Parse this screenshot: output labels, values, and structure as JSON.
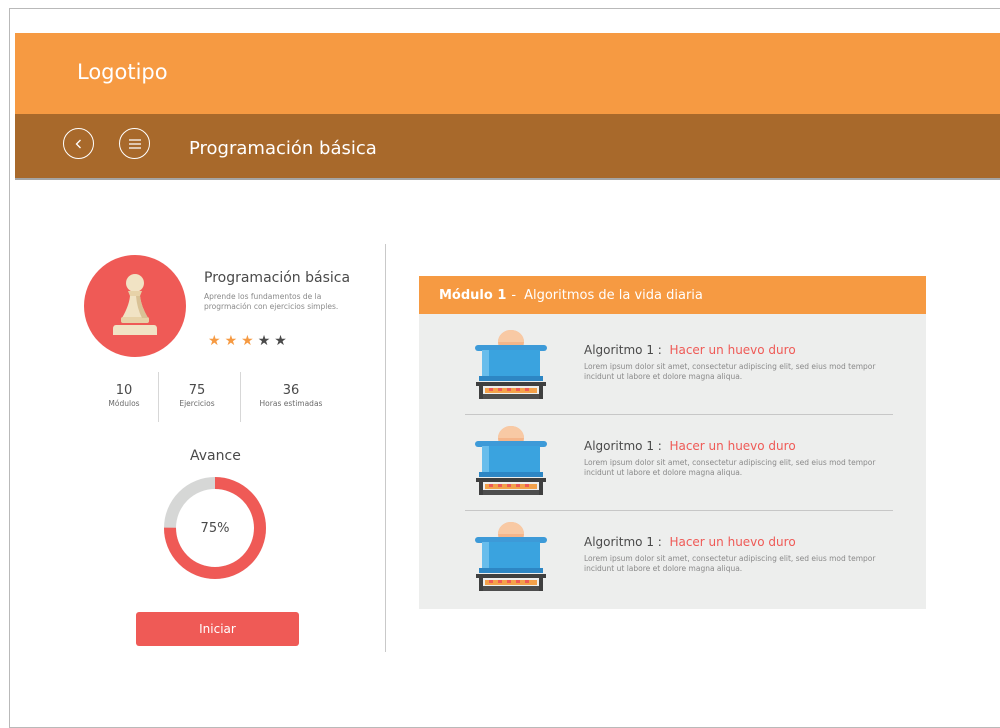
{
  "header": {
    "logo": "Logotipo"
  },
  "nav": {
    "title": "Programación básica",
    "back_icon": "chevron-left-icon",
    "menu_icon": "menu-icon"
  },
  "course": {
    "title": "Programación básica",
    "description": "Aprende los fundamentos de la progrmación con ejercicios simples.",
    "rating": 3,
    "rating_max": 5,
    "stats": [
      {
        "value": "10",
        "label": "Módulos"
      },
      {
        "value": "75",
        "label": "Ejercicios"
      },
      {
        "value": "36",
        "label": "Horas estimadas"
      }
    ],
    "progress_label": "Avance",
    "progress_text": "75%",
    "progress_value": 0.75,
    "start_label": "Iniciar"
  },
  "module": {
    "number": "Módulo 1",
    "separator": "-",
    "name": "Algoritmos de la vida diaria",
    "algorithms": [
      {
        "prefix": "Algoritmo 1 :",
        "title": "Hacer un huevo duro",
        "description": "Lorem ipsum dolor sit amet, consectetur adipiscing elit, sed eius mod tempor incidunt ut labore et dolore magna aliqua.",
        "icon": "pot-egg-stove-icon"
      },
      {
        "prefix": "Algoritmo 1 :",
        "title": "Hacer un huevo duro",
        "description": "Lorem ipsum dolor sit amet, consectetur adipiscing elit, sed eius mod tempor incidunt ut labore et dolore magna aliqua.",
        "icon": "pot-egg-stove-icon"
      },
      {
        "prefix": "Algoritmo 1 :",
        "title": "Hacer un huevo duro",
        "description": "Lorem ipsum dolor sit amet, consectetur adipiscing elit, sed eius mod tempor incidunt ut labore et dolore magna aliqua.",
        "icon": "pot-egg-stove-icon"
      }
    ]
  },
  "colors": {
    "orange": "#f69a42",
    "brown": "#a8692b",
    "red": "#ef5a56",
    "grey_panel": "#edeeed",
    "star_filled": "#f69a42",
    "star_empty": "#4a4a4a"
  }
}
